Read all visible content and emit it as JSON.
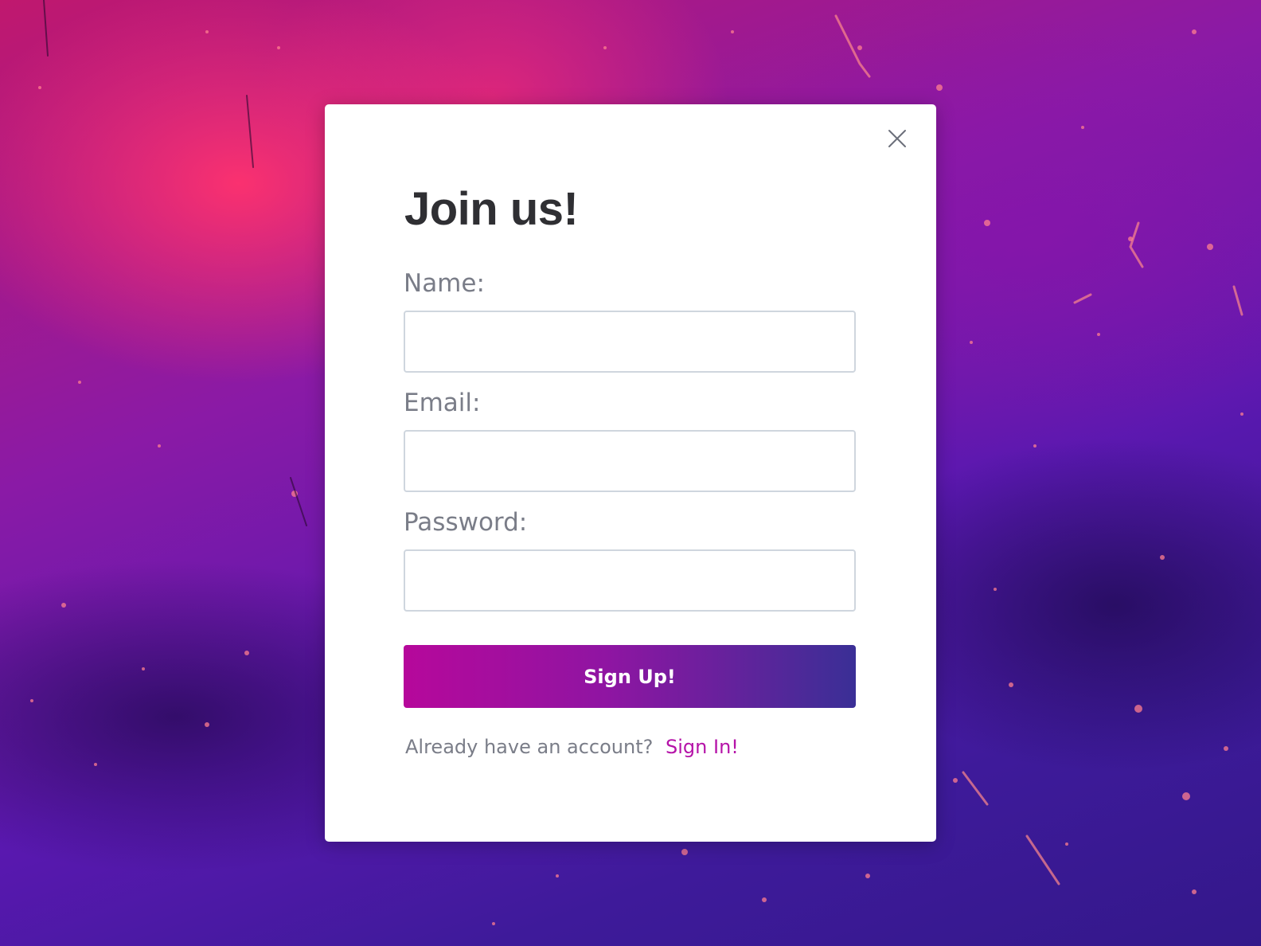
{
  "modal": {
    "title": "Join us!",
    "fields": [
      {
        "label": "Name:",
        "value": "",
        "placeholder": ""
      },
      {
        "label": "Email:",
        "value": "",
        "placeholder": ""
      },
      {
        "label": "Password:",
        "value": "",
        "placeholder": ""
      }
    ],
    "submit_label": "Sign Up!",
    "footer_text": "Already have an account?",
    "signin_label": "Sign In!"
  },
  "icons": {
    "close": "close-icon"
  },
  "colors": {
    "title": "#2f2f33",
    "label": "#7a7d88",
    "input_border": "#cfd6de",
    "button_gradient_start": "#b6089b",
    "button_gradient_end": "#3a2f96",
    "link": "#b513a8"
  }
}
